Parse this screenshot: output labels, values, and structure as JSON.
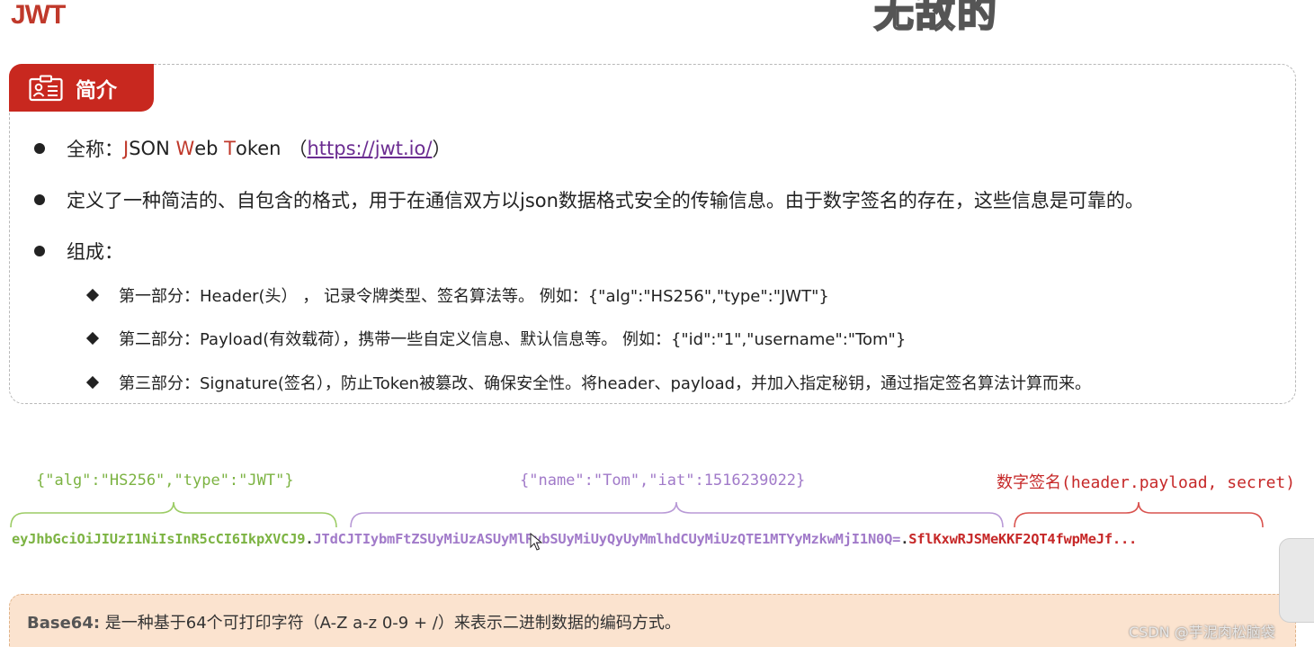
{
  "page": {
    "title": "JWT",
    "watermark_top": "无敌的"
  },
  "intro": {
    "tag_label": "简介",
    "line1": {
      "prefix": "全称：",
      "j": "J",
      "son": "SON ",
      "w": "W",
      "eb": "eb ",
      "t": "T",
      "oken": "oken",
      "paren_open": "（",
      "link": "https://jwt.io/",
      "paren_close": "）"
    },
    "line2": "定义了一种简洁的、自包含的格式，用于在通信双方以json数据格式安全的传输信息。由于数字签名的存在，这些信息是可靠的。",
    "line3": "组成：",
    "parts": [
      "第一部分：Header(头） ， 记录令牌类型、签名算法等。 例如：{\"alg\":\"HS256\",\"type\":\"JWT\"}",
      "第二部分：Payload(有效载荷），携带一些自定义信息、默认信息等。 例如：{\"id\":\"1\",\"username\":\"Tom\"}",
      "第三部分：Signature(签名），防止Token被篡改、确保安全性。将header、payload，并加入指定秘钥，通过指定签名算法计算而来。"
    ]
  },
  "diagram": {
    "header_json": "{\"alg\":\"HS256\",\"type\":\"JWT\"}",
    "payload_json": "{\"name\":\"Tom\",\"iat\":1516239022}",
    "signature_label": "数字签名(header.payload, secret)",
    "token_header": "eyJhbGciOiJIUzI1NiIsInR5cCI6IkpXVCJ9",
    "dot": ".",
    "token_payload": "JTdCJTIybmFtZSUyMiUzASUyMlRvbSUyMiUyQyUyMmlhdCUyMiUzQTE1MTYyMzkwMjI1N0Q=",
    "token_signature": "SflKxwRJSMeKKF2QT4fwpMeJf...",
    "colors": {
      "header": "#7cb342",
      "payload": "#a17ac9",
      "signature": "#c62828"
    }
  },
  "base64": {
    "label": "Base64:",
    "text": " 是一种基于64个可打印字符（A-Z a-z 0-9 + /）来表示二进制数据的编码方式。"
  },
  "watermark": "CSDN @芋泥肉松脑袋"
}
